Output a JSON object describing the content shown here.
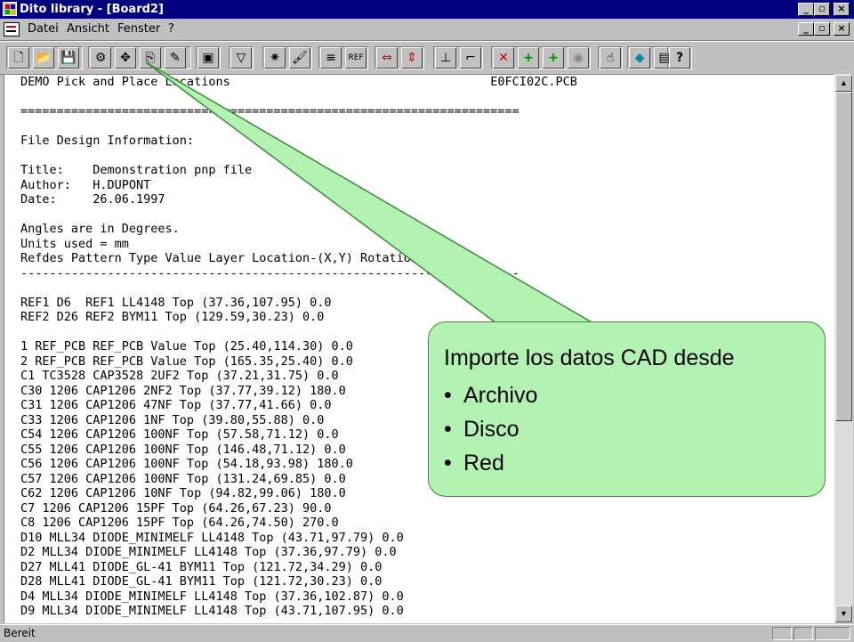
{
  "window": {
    "title": "Dito library - [Board2]"
  },
  "menu": {
    "items": [
      "Datei",
      "Ansicht",
      "Fenster",
      "?"
    ]
  },
  "toolbar": {
    "icons": [
      "new-icon",
      "open-icon",
      "save-icon",
      "settings-icon",
      "pick-icon",
      "import-icon",
      "edit-icon",
      "component-icon",
      "filter-icon",
      "explode-icon",
      "paint-icon",
      "sort-icon",
      "ref-icon",
      "mirror-h-icon",
      "mirror-v-icon",
      "axis-icon",
      "axis-rotate-icon",
      "delete-icon",
      "r1-icon",
      "r2-icon",
      "view-icon",
      "hand-icon",
      "erase-icon",
      "notes-icon",
      "help-icon"
    ]
  },
  "document": {
    "header_left": "DEMO Pick and Place Locations",
    "header_right": "E0FCI02C.PCB",
    "lines": [
      "",
      "=====================================================================",
      "",
      "File Design Information:",
      "",
      "Title:    Demonstration pnp file",
      "Author:   H.DUPONT",
      "Date:     26.06.1997",
      "",
      "Angles are in Degrees.",
      "Units used = mm",
      "Refdes Pattern Type Value Layer Location-(X,Y) Rotation",
      "---------------------------------------------------------------------",
      "",
      "REF1 D6  REF1 LL4148 Top (37.36,107.95) 0.0",
      "REF2 D26 REF2 BYM11 Top (129.59,30.23) 0.0",
      "",
      "1 REF_PCB REF_PCB Value Top (25.40,114.30) 0.0",
      "2 REF_PCB REF_PCB Value Top (165.35,25.40) 0.0",
      "C1 TC3528 CAP3528 2UF2 Top (37.21,31.75) 0.0",
      "C30 1206 CAP1206 2NF2 Top (37.77,39.12) 180.0",
      "C31 1206 CAP1206 47NF Top (37.77,41.66) 0.0",
      "C33 1206 CAP1206 1NF Top (39.80,55.88) 0.0",
      "C54 1206 CAP1206 100NF Top (57.58,71.12) 0.0",
      "C55 1206 CAP1206 100NF Top (146.48,71.12) 0.0",
      "C56 1206 CAP1206 100NF Top (54.18,93.98) 180.0",
      "C57 1206 CAP1206 100NF Top (131.24,69.85) 0.0",
      "C62 1206 CAP1206 10NF Top (94.82,99.06) 180.0",
      "C7 1206 CAP1206 15PF Top (64.26,67.23) 90.0",
      "C8 1206 CAP1206 15PF Top (64.26,74.50) 270.0",
      "D10 MLL34 DIODE_MINIMELF LL4148 Top (43.71,97.79) 0.0",
      "D2 MLL34 DIODE_MINIMELF LL4148 Top (37.36,97.79) 0.0",
      "D27 MLL41 DIODE_GL-41 BYM11 Top (121.72,34.29) 0.0",
      "D28 MLL41 DIODE_GL-41 BYM11 Top (121.72,30.23) 0.0",
      "D4 MLL34 DIODE_MINIMELF LL4148 Top (37.36,102.87) 0.0",
      "D9 MLL34 DIODE_MINIMELF LL4148 Top (43.71,107.95) 0.0"
    ]
  },
  "callout": {
    "title": "Importe los datos CAD desde",
    "items": [
      "Archivo",
      "Disco",
      "Red"
    ],
    "bullet": "•",
    "fill": "#b3f2b3",
    "border": "#3a8a3a"
  },
  "status": {
    "text": "Bereit"
  }
}
